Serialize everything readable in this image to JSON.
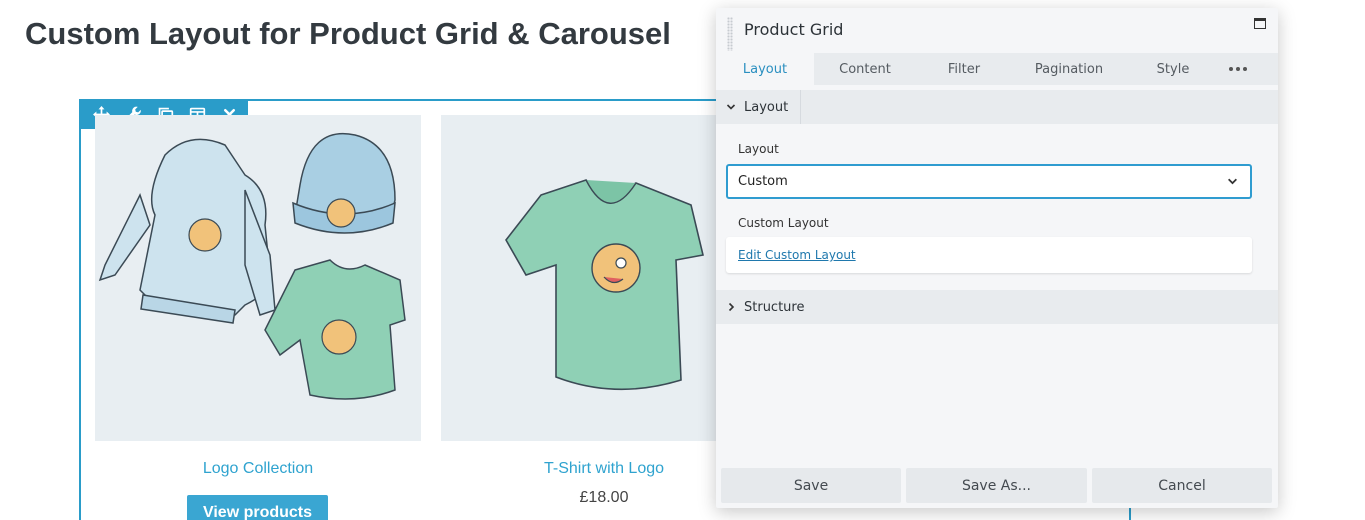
{
  "page": {
    "title": "Custom Layout for Product Grid & Carousel"
  },
  "module_toolbar": {
    "icons": [
      "move-icon",
      "wrench-icon",
      "duplicate-icon",
      "columns-icon",
      "close-icon"
    ]
  },
  "products": [
    {
      "title": "Logo Collection",
      "button_label": "View products",
      "price": ""
    },
    {
      "title": "T-Shirt with Logo",
      "button_label": "",
      "price": "£18.00"
    }
  ],
  "panel": {
    "title": "Product Grid",
    "tabs": [
      {
        "label": "Layout",
        "active": true
      },
      {
        "label": "Content",
        "active": false
      },
      {
        "label": "Filter",
        "active": false
      },
      {
        "label": "Pagination",
        "active": false
      },
      {
        "label": "Style",
        "active": false
      }
    ],
    "sections": {
      "layout": {
        "label": "Layout",
        "expanded": true
      },
      "structure": {
        "label": "Structure",
        "expanded": false
      }
    },
    "fields": {
      "layout_label": "Layout",
      "layout_value": "Custom",
      "custom_layout_label": "Custom Layout",
      "edit_link": "Edit Custom Layout"
    },
    "footer": {
      "save": "Save",
      "save_as": "Save As...",
      "cancel": "Cancel"
    }
  },
  "colors": {
    "accent": "#2a9cc9",
    "link": "#2fa3cf",
    "button": "#3aa6d2",
    "title": "#333a40"
  }
}
